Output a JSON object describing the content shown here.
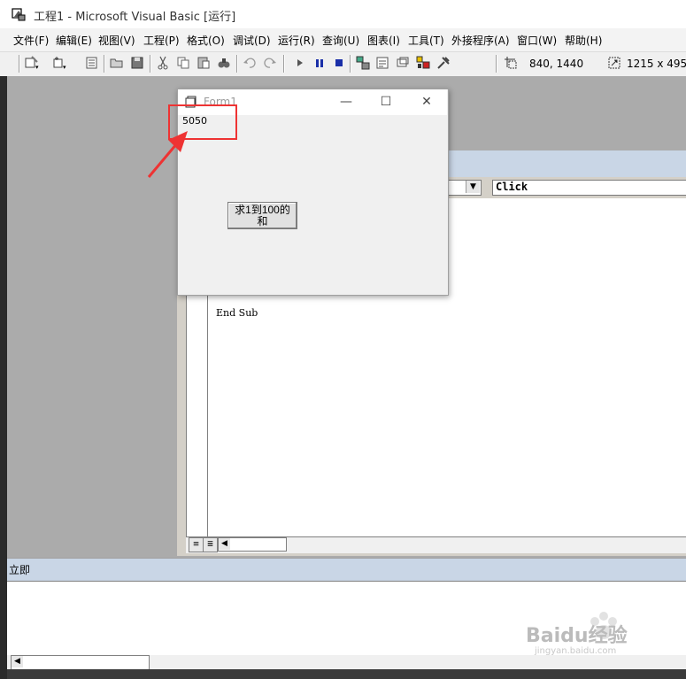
{
  "window": {
    "title": "工程1 - Microsoft Visual Basic [运行]"
  },
  "menu": [
    "文件(F)",
    "编辑(E)",
    "视图(V)",
    "工程(P)",
    "格式(O)",
    "调试(D)",
    "运行(R)",
    "查询(U)",
    "图表(I)",
    "工具(T)",
    "外接程序(A)",
    "窗口(W)",
    "帮助(H)"
  ],
  "toolbar": {
    "position_readout": "840, 1440",
    "size_readout": "1215 x 495"
  },
  "form1": {
    "caption": "Form1",
    "result_label": "5050",
    "button_label": "求1到100的和"
  },
  "code_window": {
    "procedure_combo": "Click",
    "code_line": "End Sub"
  },
  "immediate": {
    "title": "立即"
  },
  "watermark": {
    "text": "Baidu经验",
    "sub": "jingyan.baidu.com"
  },
  "colors": {
    "highlight": "#ee3333",
    "mdi_background": "#ababab"
  }
}
